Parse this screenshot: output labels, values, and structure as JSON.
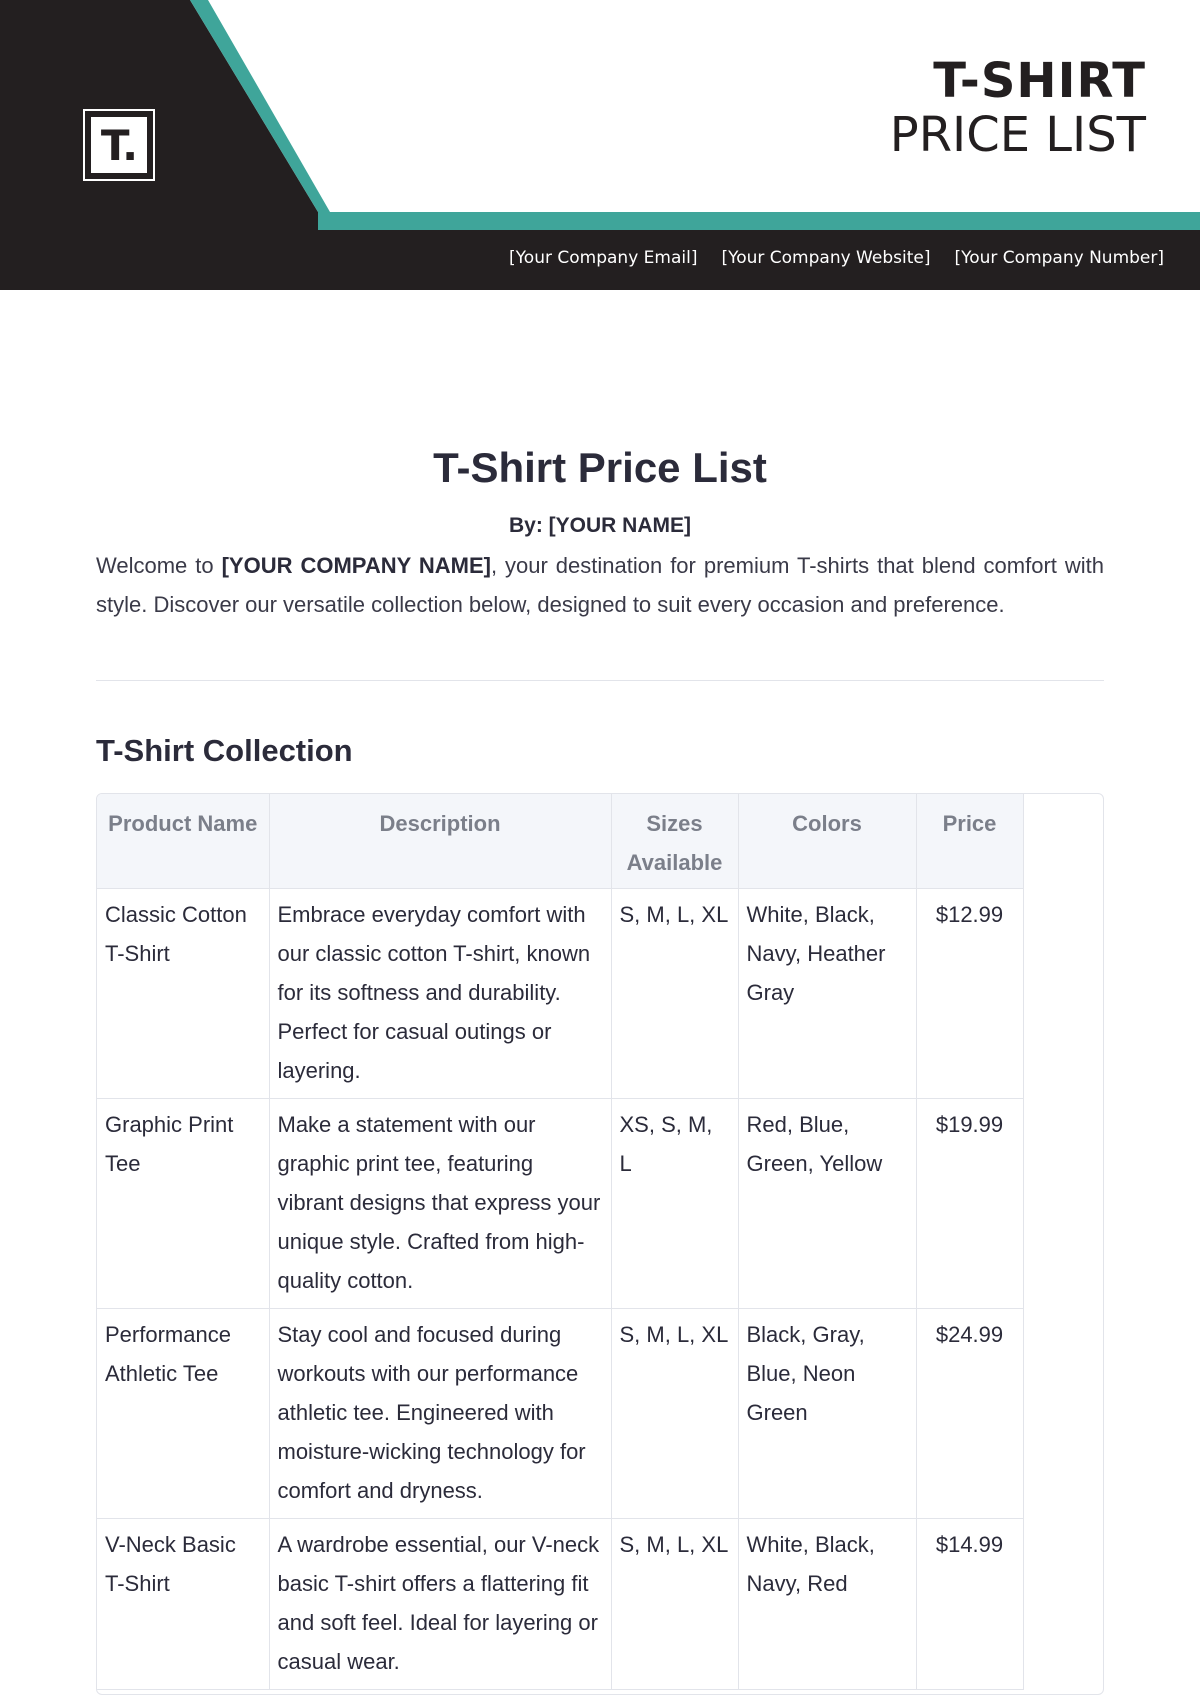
{
  "header": {
    "logo_letter": "T.",
    "title_line1": "T-SHIRT",
    "title_line2": "PRICE LIST",
    "contacts": [
      "[Your Company Email]",
      "[Your Company Website]",
      "[Your Company Number]"
    ],
    "colors": {
      "dark": "#231f20",
      "teal": "#3fa59a"
    }
  },
  "document": {
    "title": "T-Shirt Price List",
    "byline": "By: [YOUR NAME]",
    "intro_prefix": "Welcome to ",
    "intro_company": "[YOUR COMPANY NAME]",
    "intro_suffix": ", your destination for premium T-shirts that blend comfort with style. Discover our versatile collection below, designed to suit every occasion and preference.",
    "section_title": "T-Shirt Collection"
  },
  "table": {
    "headers": [
      "Product Name",
      "Description",
      "Sizes Available",
      "Colors",
      "Price"
    ],
    "rows": [
      {
        "name": "Classic Cotton T-Shirt",
        "description": "Embrace everyday comfort with our classic cotton T-shirt, known for its softness and durability. Perfect for casual outings or layering.",
        "sizes": "S, M, L, XL",
        "colors": "White, Black, Navy, Heather Gray",
        "price": "$12.99"
      },
      {
        "name": "Graphic Print Tee",
        "description": "Make a statement with our graphic print tee, featuring vibrant designs that express your unique style. Crafted from high-quality cotton.",
        "sizes": "XS, S, M, L",
        "colors": "Red, Blue, Green, Yellow",
        "price": "$19.99"
      },
      {
        "name": "Performance Athletic Tee",
        "description": "Stay cool and focused during workouts with our performance athletic tee. Engineered with moisture-wicking technology for comfort and dryness.",
        "sizes": "S, M, L, XL",
        "colors": "Black, Gray, Blue, Neon Green",
        "price": "$24.99"
      },
      {
        "name": "V-Neck Basic T-Shirt",
        "description": "A wardrobe essential, our V-neck basic T-shirt offers a flattering fit and soft feel. Ideal for layering or casual wear.",
        "sizes": "S, M, L, XL",
        "colors": "White, Black, Navy, Red",
        "price": "$14.99"
      }
    ]
  }
}
